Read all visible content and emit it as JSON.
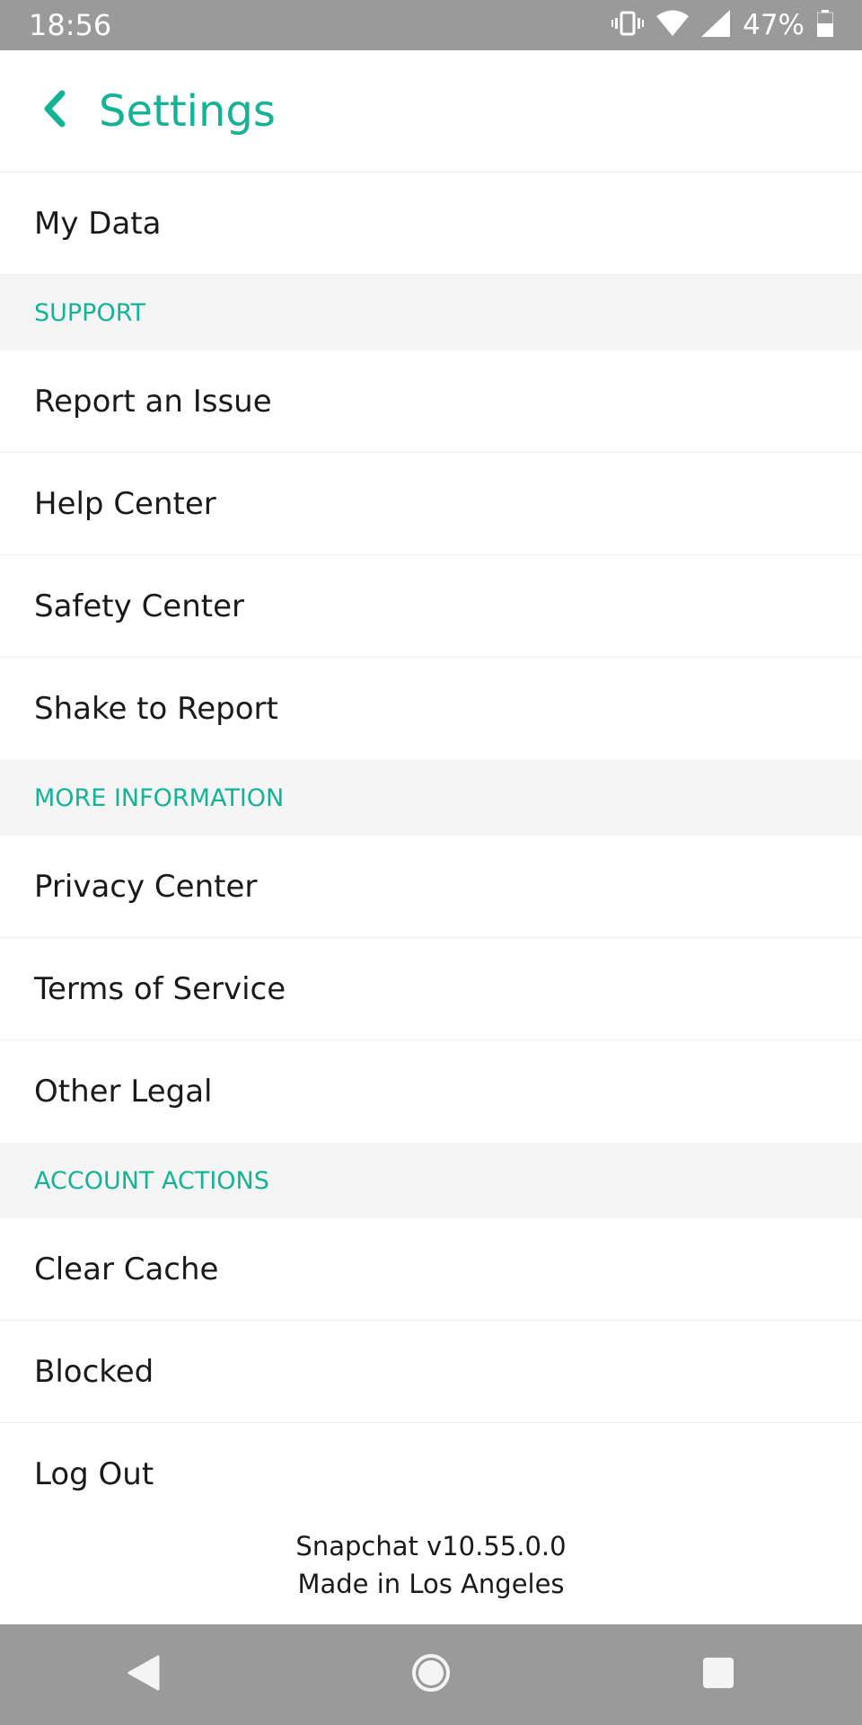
{
  "status_bar": {
    "time": "18:56",
    "battery_percent": "47%",
    "icons": [
      "vibrate-icon",
      "wifi-icon",
      "signal-icon",
      "battery-icon"
    ]
  },
  "header": {
    "title": "Settings",
    "back_icon": "chevron-left-icon"
  },
  "colors": {
    "accent": "#14b396",
    "section_background": "#f5f5f5",
    "system_bar": "#9a9a9a"
  },
  "items": {
    "my_data": "My Data",
    "report_issue": "Report an Issue",
    "help_center": "Help Center",
    "safety_center": "Safety Center",
    "shake_to_report": "Shake to Report",
    "privacy_center": "Privacy Center",
    "terms_of_service": "Terms of Service",
    "other_legal": "Other Legal",
    "clear_cache": "Clear Cache",
    "blocked": "Blocked",
    "log_out": "Log Out"
  },
  "sections": {
    "support": "SUPPORT",
    "more_information": "MORE INFORMATION",
    "account_actions": "ACCOUNT ACTIONS"
  },
  "footer": {
    "version": "Snapchat v10.55.0.0",
    "made_in": "Made in Los Angeles"
  },
  "nav_bar": {
    "icons": [
      "back-triangle-icon",
      "home-circle-icon",
      "recents-square-icon"
    ]
  }
}
